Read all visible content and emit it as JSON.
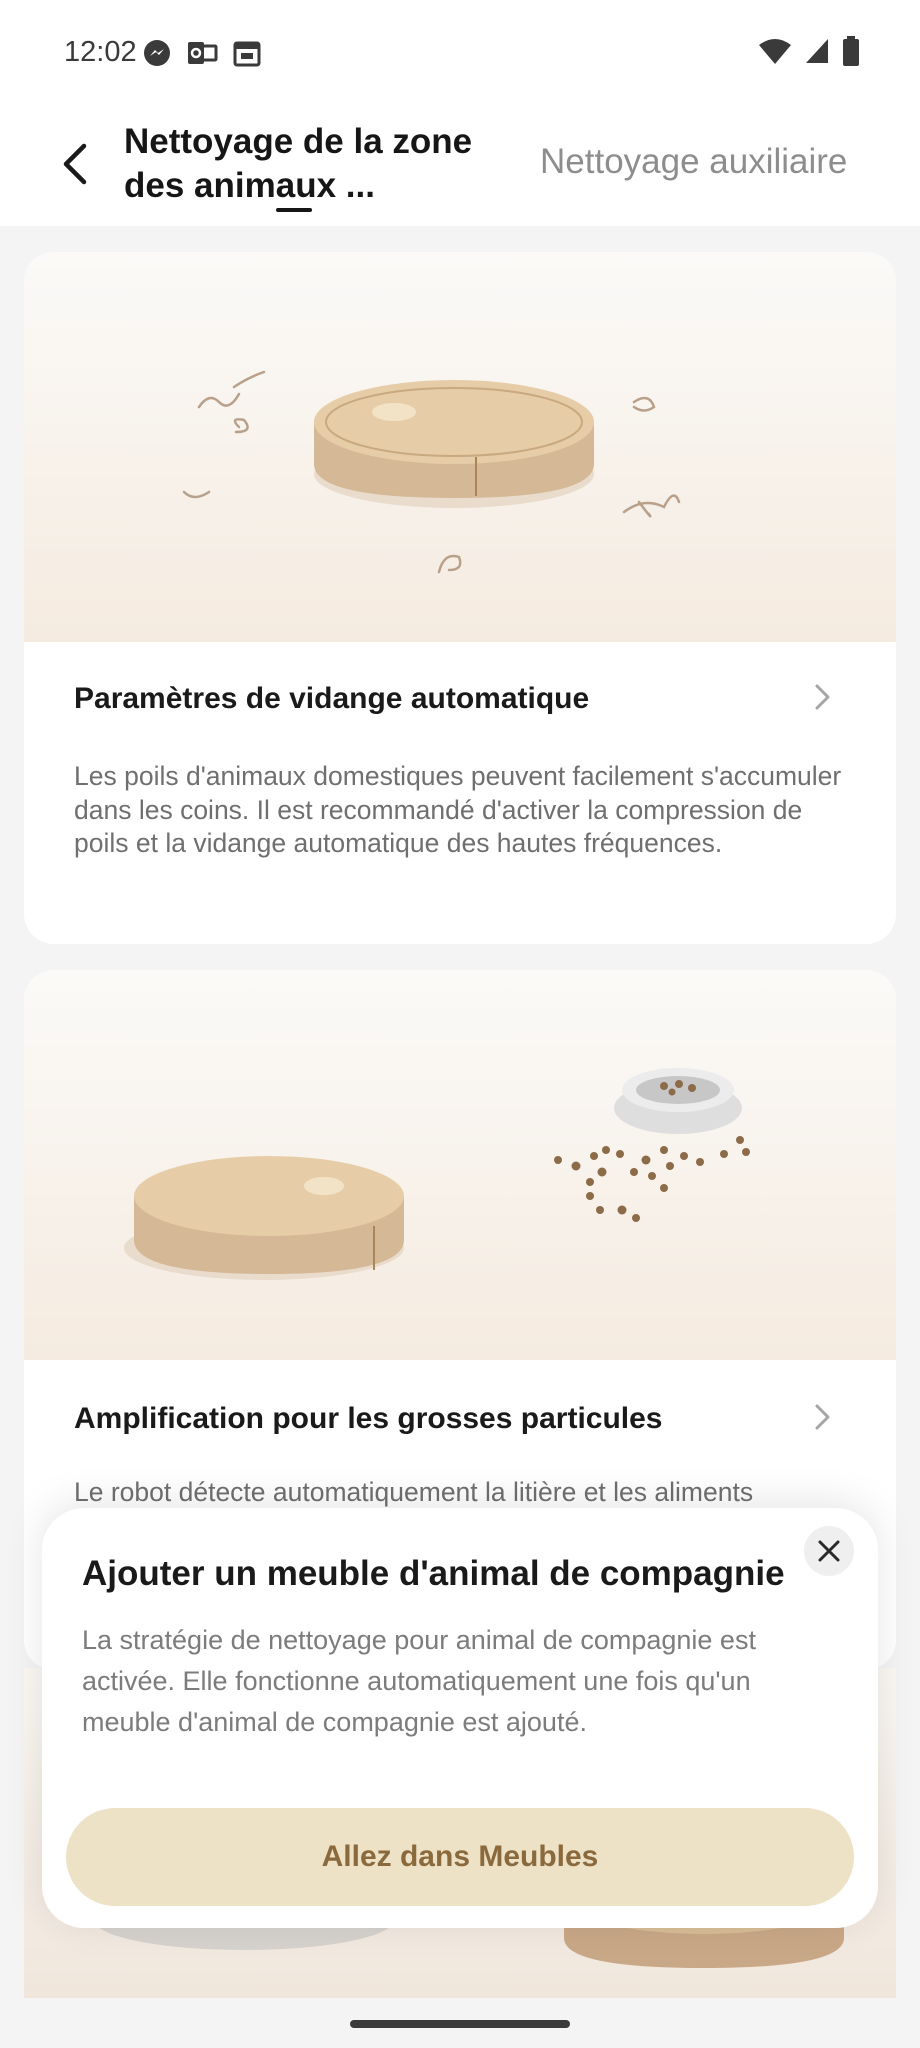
{
  "status_bar": {
    "time": "12:02",
    "left_icons": [
      "messenger-icon",
      "outlook-icon",
      "calendar-icon"
    ],
    "right_icons": [
      "wifi-icon",
      "signal-icon",
      "battery-icon"
    ]
  },
  "header": {
    "title": "Nettoyage de la zone des animaux ...",
    "secondary_tab": "Nettoyage auxiliaire"
  },
  "cards": [
    {
      "title": "Paramètres de vidange automatique",
      "description": "Les poils d'animaux domestiques peuvent facilement s'accumuler dans les coins. Il est recommandé d'activer la compression de poils et la vidange automatique des hautes fréquences."
    },
    {
      "title": "Amplification pour les grosses particules",
      "description": "Le robot détecte automatiquement la litière et les aliments"
    }
  ],
  "popup": {
    "title": "Ajouter un meuble d'animal de compagnie",
    "description": "La stratégie de nettoyage pour animal de compagnie est activée. Elle fonctionne automatiquement une fois qu'un meuble d'animal de compagnie est ajouté.",
    "button_label": "Allez dans Meubles"
  },
  "colors": {
    "accent_button_bg": "#ede1c6",
    "accent_button_text": "#8a6a3d",
    "robot_tan": "#d9bd98"
  }
}
